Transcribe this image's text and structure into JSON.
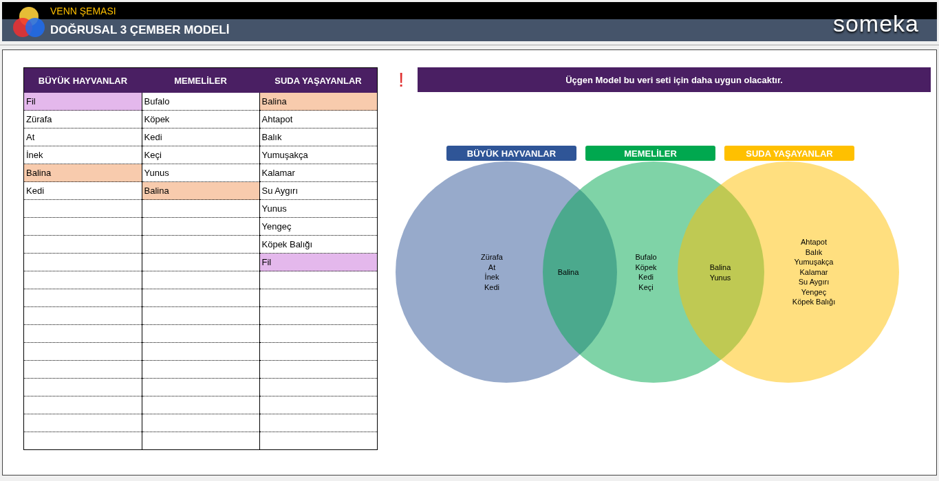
{
  "header": {
    "subtitle": "VENN ŞEMASI",
    "title": "DOĞRUSAL 3 ÇEMBER MODELİ",
    "brand": "someka"
  },
  "table": {
    "columns": [
      {
        "heading": "BÜYÜK HAYVANLAR",
        "cells": [
          {
            "text": "Fil",
            "color": "#e4b8ec"
          },
          {
            "text": "Zürafa"
          },
          {
            "text": "At"
          },
          {
            "text": "İnek"
          },
          {
            "text": "Balina",
            "color": "#f8cbad"
          },
          {
            "text": "Kedi"
          }
        ]
      },
      {
        "heading": "MEMELİLER",
        "cells": [
          {
            "text": "Bufalo"
          },
          {
            "text": "Köpek"
          },
          {
            "text": "Kedi"
          },
          {
            "text": "Keçi"
          },
          {
            "text": "Yunus"
          },
          {
            "text": "Balina",
            "color": "#f8cbad"
          }
        ]
      },
      {
        "heading": "SUDA YAŞAYANLAR",
        "cells": [
          {
            "text": "Balina",
            "color": "#f8cbad"
          },
          {
            "text": "Ahtapot"
          },
          {
            "text": "Balık"
          },
          {
            "text": "Yumuşakça"
          },
          {
            "text": "Kalamar"
          },
          {
            "text": "Su Aygırı"
          },
          {
            "text": "Yunus"
          },
          {
            "text": "Yengeç"
          },
          {
            "text": "Köpek Balığı"
          },
          {
            "text": "Fil",
            "color": "#e4b8ec"
          }
        ]
      }
    ]
  },
  "notice": {
    "mark": "!",
    "message": "Üçgen Model bu veri seti için daha uygun olacaktır."
  },
  "venn": {
    "sets": [
      {
        "label": "BÜYÜK HAYVANLAR",
        "color": "#2f5597",
        "items": [
          "Zürafa",
          "At",
          "İnek",
          "Kedi"
        ]
      },
      {
        "label": "MEMELİLER",
        "color": "#00a84f",
        "items": [
          "Bufalo",
          "Köpek",
          "Kedi",
          "Keçi"
        ]
      },
      {
        "label": "SUDA YAŞAYANLAR",
        "color": "#ffc000",
        "items": [
          "Ahtapot",
          "Balık",
          "Yumuşakça",
          "Kalamar",
          "Su Aygırı",
          "Yengeç",
          "Köpek Balığı"
        ]
      }
    ],
    "overlaps": [
      [
        "Balina"
      ],
      [
        "Balina",
        "Yunus"
      ]
    ]
  }
}
